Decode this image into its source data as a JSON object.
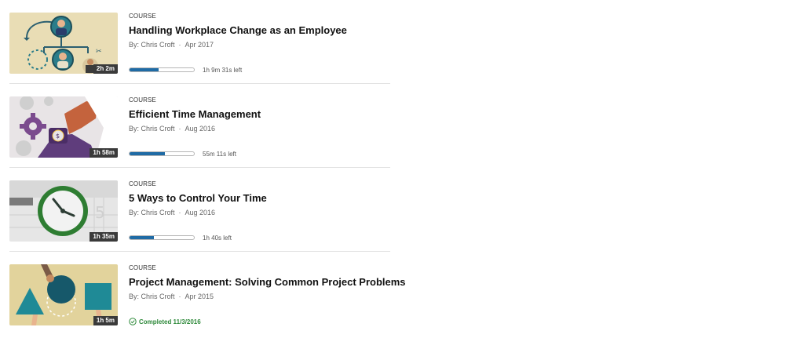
{
  "courses": [
    {
      "type_label": "COURSE",
      "title": "Handling Workplace Change as an Employee",
      "author": "By: Chris Croft",
      "date": "Apr 2017",
      "duration": "2h 2m",
      "progress": 0.45,
      "time_left": "1h 9m 31s left",
      "thumbnail_icon": "org-chart-people-icon",
      "colors": {
        "bg": "#e9ddb5",
        "accent": "#2b7d8a"
      }
    },
    {
      "type_label": "COURSE",
      "title": "Efficient Time Management",
      "author": "By: Chris Croft",
      "date": "Aug 2016",
      "duration": "1h 58m",
      "progress": 0.55,
      "time_left": "55m 11s left",
      "thumbnail_icon": "gear-wristwatch-icon",
      "colors": {
        "bg": "#e8e4e6",
        "accent": "#7b4b8e"
      }
    },
    {
      "type_label": "COURSE",
      "title": "5 Ways to Control Your Time",
      "author": "By: Chris Croft",
      "date": "Aug 2016",
      "duration": "1h 35m",
      "progress": 0.38,
      "time_left": "1h 40s left",
      "thumbnail_icon": "clock-icon",
      "colors": {
        "bg": "#e6e6e6",
        "accent": "#2e8b3a"
      }
    },
    {
      "type_label": "COURSE",
      "title": "Project Management: Solving Common Project Problems",
      "author": "By: Chris Croft",
      "date": "Apr 2015",
      "duration": "1h 5m",
      "completed_text": "Completed 11/3/2016",
      "thumbnail_icon": "shapes-puzzle-icon",
      "colors": {
        "bg": "#e2d39c",
        "accent": "#1f8a96"
      }
    }
  ],
  "colors": {
    "progress_fill": "#1f6ba5",
    "completed": "#2f8a3b"
  }
}
